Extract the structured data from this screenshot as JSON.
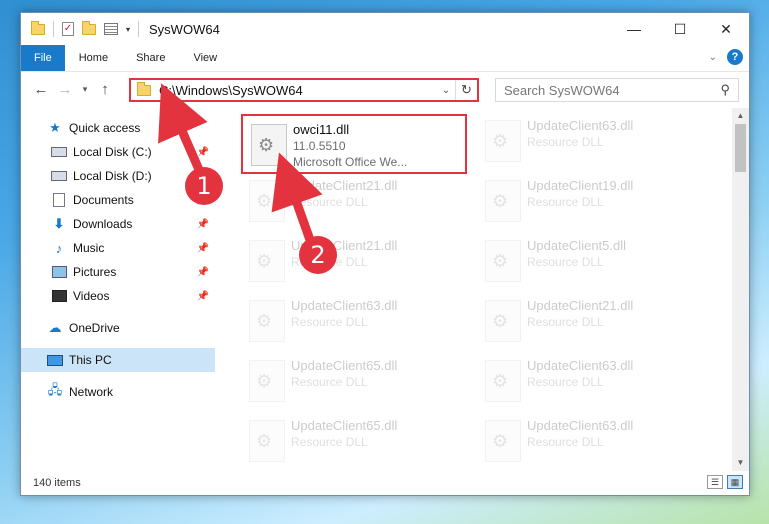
{
  "window": {
    "title": "SysWOW64"
  },
  "ribbon": {
    "tabs": [
      "File",
      "Home",
      "Share",
      "View"
    ]
  },
  "address": {
    "path": "C:\\Windows\\SysWOW64"
  },
  "search": {
    "placeholder": "Search SysWOW64"
  },
  "sidebar": {
    "quick_access": "Quick access",
    "items": [
      "Local Disk (C:)",
      "Local Disk (D:)",
      "Documents",
      "Downloads",
      "Music",
      "Pictures",
      "Videos"
    ],
    "onedrive": "OneDrive",
    "this_pc": "This PC",
    "network": "Network"
  },
  "highlighted_file": {
    "name": "owci11.dll",
    "version": "11.0.5510",
    "description": "Microsoft Office We..."
  },
  "files": [
    {
      "name": "UpdateClient63.dll",
      "sub": "Resource DLL"
    },
    {
      "name": "UpdateClient21.dll",
      "sub": "Resource DLL"
    },
    {
      "name": "UpdateClient19.dll",
      "sub": "Resource DLL"
    },
    {
      "name": "UpdateClient21.dll",
      "sub": "Resource DLL"
    },
    {
      "name": "UpdateClient5.dll",
      "sub": "Resource DLL"
    },
    {
      "name": "UpdateClient63.dll",
      "sub": "Resource DLL"
    },
    {
      "name": "UpdateClient21.dll",
      "sub": "Resource DLL"
    },
    {
      "name": "UpdateClient65.dll",
      "sub": "Resource DLL"
    },
    {
      "name": "UpdateClient63.dll",
      "sub": "Resource DLL"
    },
    {
      "name": "UpdateClient65.dll",
      "sub": "Resource DLL"
    },
    {
      "name": "UpdateClient63.dll",
      "sub": "Resource DLL"
    }
  ],
  "status": {
    "item_count": "140 items"
  },
  "annotations": {
    "badge1": "1",
    "badge2": "2"
  },
  "colors": {
    "accent": "#1979ca",
    "highlight": "#e2333f"
  }
}
